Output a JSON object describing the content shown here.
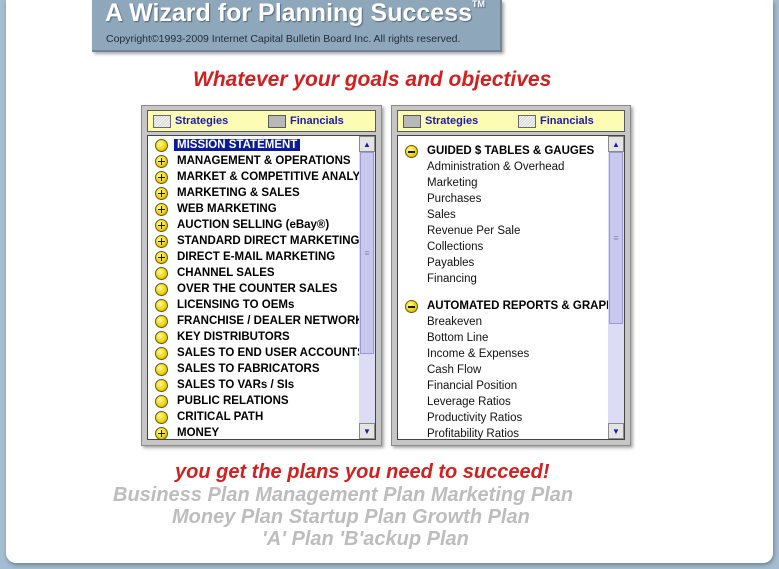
{
  "header": {
    "title": "A Wizard for Planning Success",
    "trademark": "TM",
    "copyright": "Copyright©1993-2009 Internet Capital Bulletin Board Inc. All rights reserved."
  },
  "tagline": "Whatever your goals and objectives",
  "left_panel": {
    "tabs": [
      {
        "label": "Strategies",
        "icon": "checkbox-striped-icon"
      },
      {
        "label": "Financials",
        "icon": "checkbox-gray-icon"
      }
    ],
    "items": [
      {
        "label": "MISSION STATEMENT",
        "bullet": "dot",
        "selected": true
      },
      {
        "label": "MANAGEMENT & OPERATIONS",
        "bullet": "plus"
      },
      {
        "label": "MARKET & COMPETITIVE ANALYSIS",
        "bullet": "plus"
      },
      {
        "label": "MARKETING & SALES",
        "bullet": "plus"
      },
      {
        "label": "WEB MARKETING",
        "bullet": "plus"
      },
      {
        "label": "AUCTION SELLING (eBay®)",
        "bullet": "plus"
      },
      {
        "label": "STANDARD DIRECT MARKETING",
        "bullet": "plus"
      },
      {
        "label": "DIRECT E-MAIL MARKETING",
        "bullet": "plus"
      },
      {
        "label": "CHANNEL SALES",
        "bullet": "dot"
      },
      {
        "label": "OVER THE COUNTER SALES",
        "bullet": "dot"
      },
      {
        "label": "LICENSING TO OEMs",
        "bullet": "dot"
      },
      {
        "label": "FRANCHISE / DEALER NETWORK",
        "bullet": "dot"
      },
      {
        "label": "KEY DISTRIBUTORS",
        "bullet": "dot"
      },
      {
        "label": "SALES TO END USER ACCOUNTS",
        "bullet": "dot"
      },
      {
        "label": "SALES TO FABRICATORS",
        "bullet": "dot"
      },
      {
        "label": "SALES TO VARs / SIs",
        "bullet": "dot"
      },
      {
        "label": "PUBLIC RELATIONS",
        "bullet": "dot"
      },
      {
        "label": "CRITICAL PATH",
        "bullet": "dot"
      },
      {
        "label": "MONEY",
        "bullet": "plus"
      }
    ]
  },
  "right_panel": {
    "tabs": [
      {
        "label": "Strategies",
        "icon": "checkbox-gray-icon"
      },
      {
        "label": "Financials",
        "icon": "checkbox-striped-icon"
      }
    ],
    "groups": [
      {
        "label": "GUIDED $ TABLES & GAUGES",
        "bullet": "minus",
        "items": [
          "Administration & Overhead",
          "Marketing",
          "Purchases",
          "Sales",
          "Revenue Per Sale",
          "Collections",
          "Payables",
          "Financing"
        ]
      },
      {
        "label": "AUTOMATED REPORTS & GRAPHS",
        "bullet": "minus",
        "items": [
          "Breakeven",
          "Bottom Line",
          "Income & Expenses",
          "Cash Flow",
          "Financial Position",
          "Leverage Ratios",
          "Productivity Ratios",
          "Profitability Ratios"
        ]
      }
    ]
  },
  "closing": "you get the plans you need to succeed!",
  "plans": {
    "line1": "Business Plan  Management Plan  Marketing Plan",
    "line2": "Money Plan  Startup Plan  Growth Plan",
    "line3": "'A' Plan 'B'ackup Plan"
  },
  "colors": {
    "accent_red": "#d22020",
    "header_bg": "#8fa7ba",
    "tab_bg": "#fcfcb4",
    "selection": "#0a1b9c",
    "plans_gray": "#bdbdbd"
  }
}
